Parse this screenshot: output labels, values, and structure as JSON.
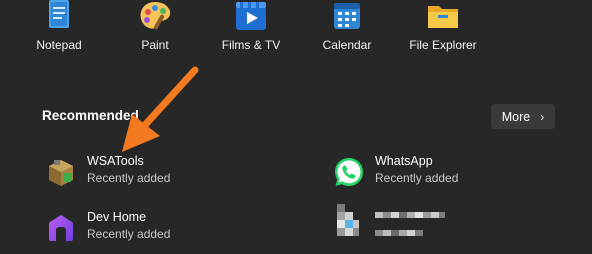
{
  "pinned": [
    {
      "label": "Notepad",
      "icon": "notepad-icon"
    },
    {
      "label": "Paint",
      "icon": "paint-palette-icon"
    },
    {
      "label": "Films & TV",
      "icon": "films-tv-icon"
    },
    {
      "label": "Calendar",
      "icon": "calendar-icon"
    },
    {
      "label": "File Explorer",
      "icon": "folder-icon"
    }
  ],
  "recommended": {
    "title": "Recommended",
    "more_label": "More",
    "items": [
      {
        "name": "WSATools",
        "subtitle": "Recently added",
        "icon": "wsatools-box-icon"
      },
      {
        "name": "WhatsApp",
        "subtitle": "Recently added",
        "icon": "whatsapp-icon"
      },
      {
        "name": "Dev Home",
        "subtitle": "Recently added",
        "icon": "dev-home-icon"
      },
      {
        "name": "",
        "subtitle": "",
        "icon": "blurred-app-icon"
      }
    ]
  },
  "annotation": {
    "arrow_color": "#f47a20"
  },
  "colors": {
    "background": "#272727",
    "more_button": "#3a3a3a",
    "whatsapp": "#25d366"
  }
}
